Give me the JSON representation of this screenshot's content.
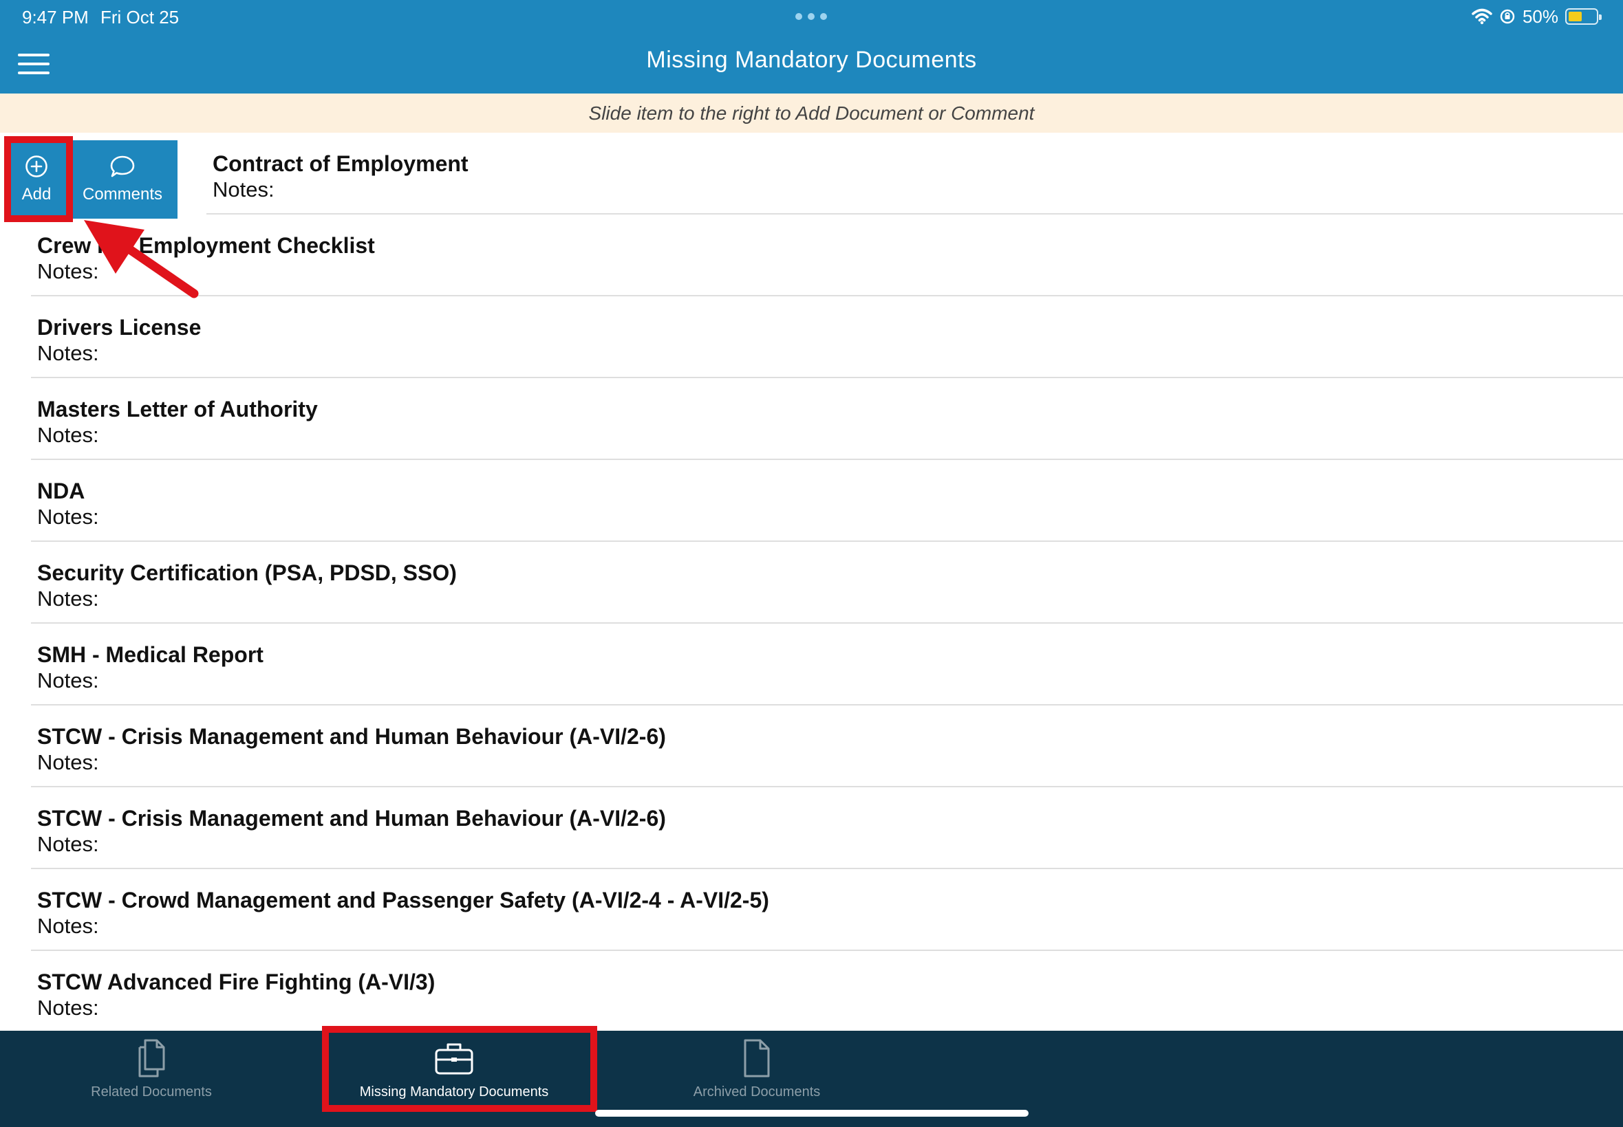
{
  "status_bar": {
    "time": "9:47 PM",
    "date": "Fri Oct 25",
    "battery_percent": "50%",
    "battery_level": 0.5,
    "icons": [
      "wifi-icon",
      "orientation-lock-icon",
      "battery-icon"
    ]
  },
  "header": {
    "title": "Missing Mandatory Documents",
    "menu_icon": "hamburger-menu-icon"
  },
  "hint": {
    "text": "Slide item to the right to Add Document or Comment"
  },
  "swipe_actions": {
    "add_label": "Add",
    "comments_label": "Comments"
  },
  "documents": [
    {
      "title": "Contract of Employment",
      "notes": "Notes:"
    },
    {
      "title": "Crew Pre Employment Checklist",
      "notes": "Notes:"
    },
    {
      "title": "Drivers License",
      "notes": "Notes:"
    },
    {
      "title": "Masters Letter of Authority",
      "notes": "Notes:"
    },
    {
      "title": "NDA",
      "notes": "Notes:"
    },
    {
      "title": "Security Certification (PSA, PDSD, SSO)",
      "notes": "Notes:"
    },
    {
      "title": "SMH - Medical Report",
      "notes": "Notes:"
    },
    {
      "title": "STCW - Crisis Management and Human Behaviour (A-VI/2-6)",
      "notes": "Notes:"
    },
    {
      "title": "STCW - Crisis Management and Human Behaviour (A-VI/2-6)",
      "notes": "Notes:"
    },
    {
      "title": "STCW - Crowd Management and Passenger Safety (A-VI/2-4 - A-VI/2-5)",
      "notes": "Notes:"
    },
    {
      "title": "STCW Advanced Fire Fighting (A-VI/3)",
      "notes": "Notes:"
    }
  ],
  "tabs": [
    {
      "label": "Related Documents",
      "icon": "documents-icon",
      "active": false
    },
    {
      "label": "Missing Mandatory Documents",
      "icon": "briefcase-icon",
      "active": true
    },
    {
      "label": "Archived Documents",
      "icon": "document-icon",
      "active": false
    }
  ],
  "colors": {
    "header_blue": "#1e87bd",
    "hint_background": "#fdf0dd",
    "tab_bar": "#0d3348",
    "highlight_red": "#e0131b",
    "battery_yellow": "#f5cc1c"
  }
}
